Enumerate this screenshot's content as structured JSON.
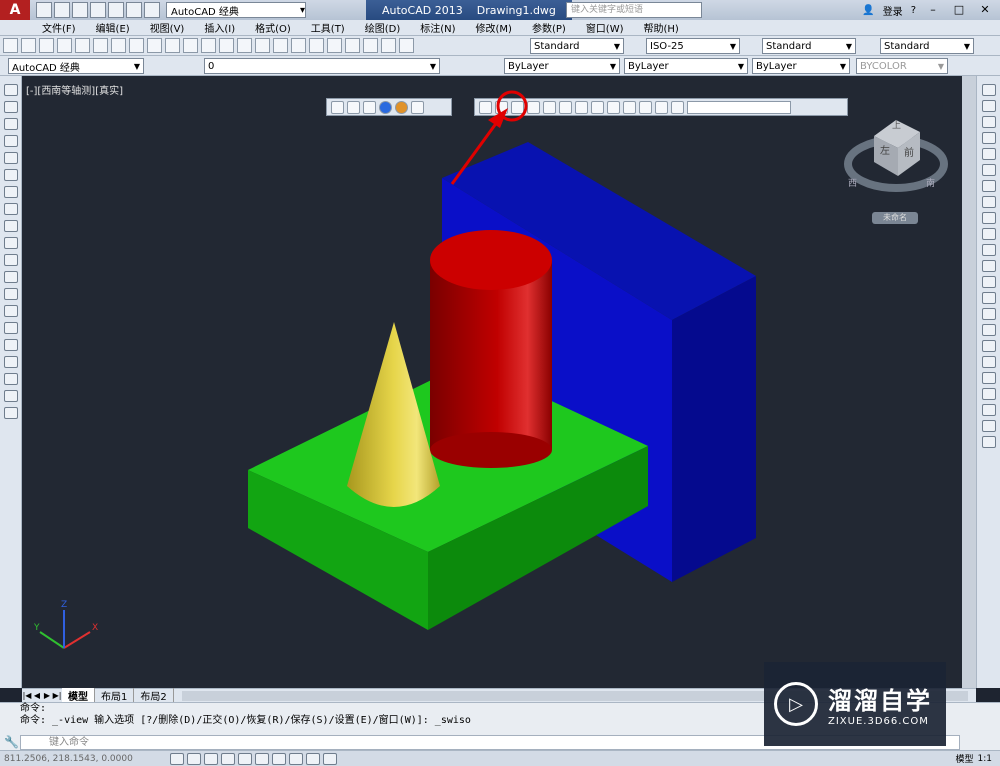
{
  "titlebar": {
    "workspace": "AutoCAD 经典",
    "app_name": "AutoCAD 2013",
    "file_name": "Drawing1.dwg",
    "search_placeholder": "键入关键字或短语",
    "login": "登录"
  },
  "menu": [
    "文件(F)",
    "编辑(E)",
    "视图(V)",
    "插入(I)",
    "格式(O)",
    "工具(T)",
    "绘图(D)",
    "标注(N)",
    "修改(M)",
    "参数(P)",
    "窗口(W)",
    "帮助(H)"
  ],
  "toolbar1": {
    "text_style": "Standard",
    "dim_style": "ISO-25",
    "table_style": "Standard",
    "mleader_style": "Standard"
  },
  "toolbar2": {
    "workspace": "AutoCAD 经典",
    "layer": "0",
    "color": "ByLayer",
    "linetype": "ByLayer",
    "lineweight": "ByLayer",
    "plotstyle": "BYCOLOR"
  },
  "viewport": {
    "label": "[-][西南等轴测][真实]",
    "viewcube_top": "上",
    "viewcube_left": "左",
    "viewcube_front": "前",
    "compass_west": "西",
    "compass_south": "南",
    "ucs_name": "未命名"
  },
  "tabs": [
    "模型",
    "布局1",
    "布局2"
  ],
  "command": {
    "line1": "命令:",
    "line2": "命令: _-view 输入选项 [?/删除(D)/正交(O)/恢复(R)/保存(S)/设置(E)/窗口(W)]: _swiso",
    "input_placeholder": "键入命令"
  },
  "status": {
    "coords": "811.2506, 218.1543, 0.0000",
    "model": "模型",
    "scale": "1:1"
  },
  "watermark": {
    "title": "溜溜自学",
    "url": "ZIXUE.3D66.COM"
  },
  "colors": {
    "viewport_bg": "#222833",
    "blue_box": "#0a10b4",
    "green_slab": "#15b515",
    "red_cylinder": "#c00000",
    "yellow_cone": "#d9c533",
    "annotation": "#e00000"
  }
}
